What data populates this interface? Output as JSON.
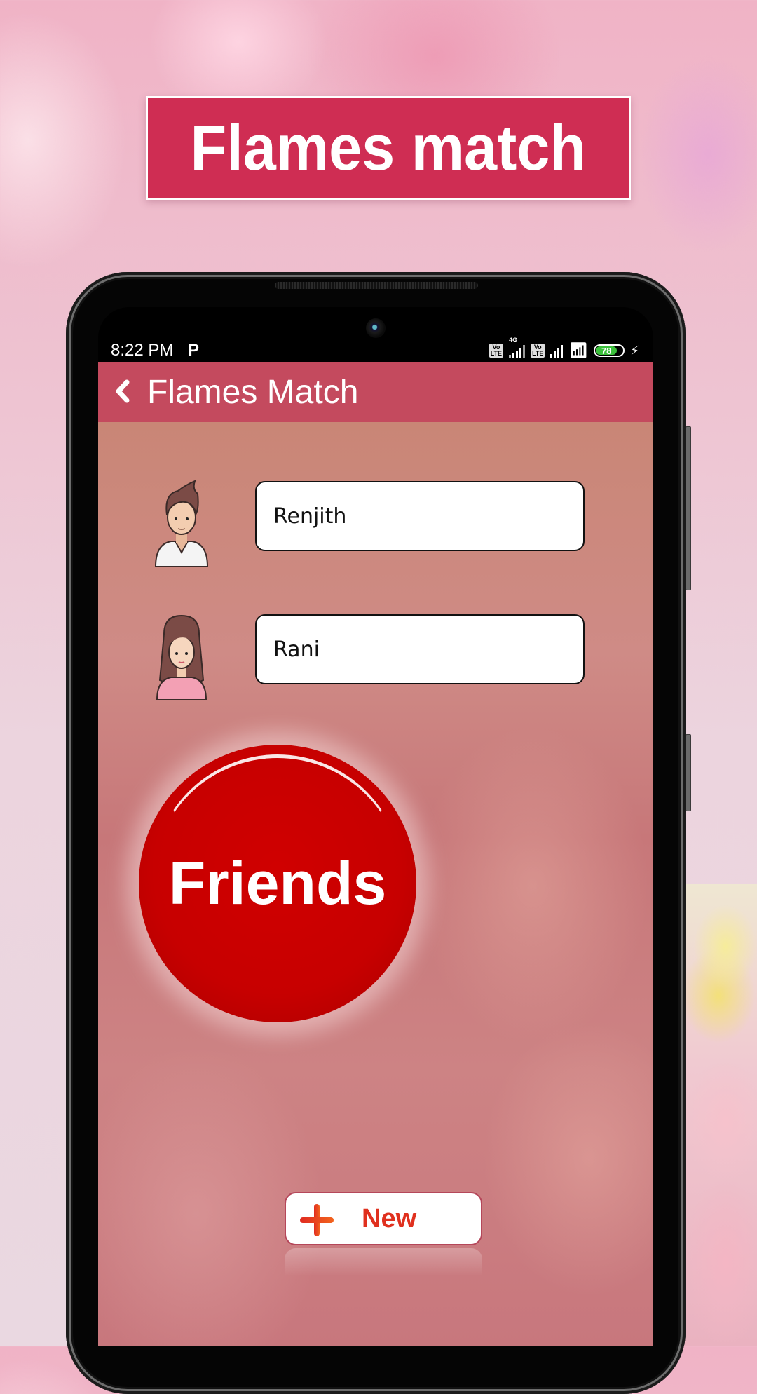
{
  "banner": {
    "title": "Flames match"
  },
  "status_bar": {
    "time": "8:22 PM",
    "notification_icon": "parking-p-icon",
    "sim1_label": "Vo LTE",
    "network_type": "4G",
    "sim2_label": "Vo LTE",
    "wifi_icon": "wifi-icon",
    "battery_percent": "78",
    "battery_level": 0.78,
    "charging_icon": "bolt-icon"
  },
  "app_bar": {
    "back_icon": "chevron-left-icon",
    "title": "Flames Match"
  },
  "form": {
    "person1": {
      "avatar": "boy-avatar",
      "name_value": "Renjith"
    },
    "person2": {
      "avatar": "girl-avatar",
      "name_value": "Rani"
    }
  },
  "result": {
    "label": "Friends"
  },
  "new_button": {
    "icon": "plus-icon",
    "label": "New"
  },
  "colors": {
    "banner_bg": "#cf2d53",
    "app_bar_bg": "#c44a5e",
    "result_red": "#c70000",
    "new_label": "#e0301e",
    "battery_green": "#3bbf3b"
  }
}
